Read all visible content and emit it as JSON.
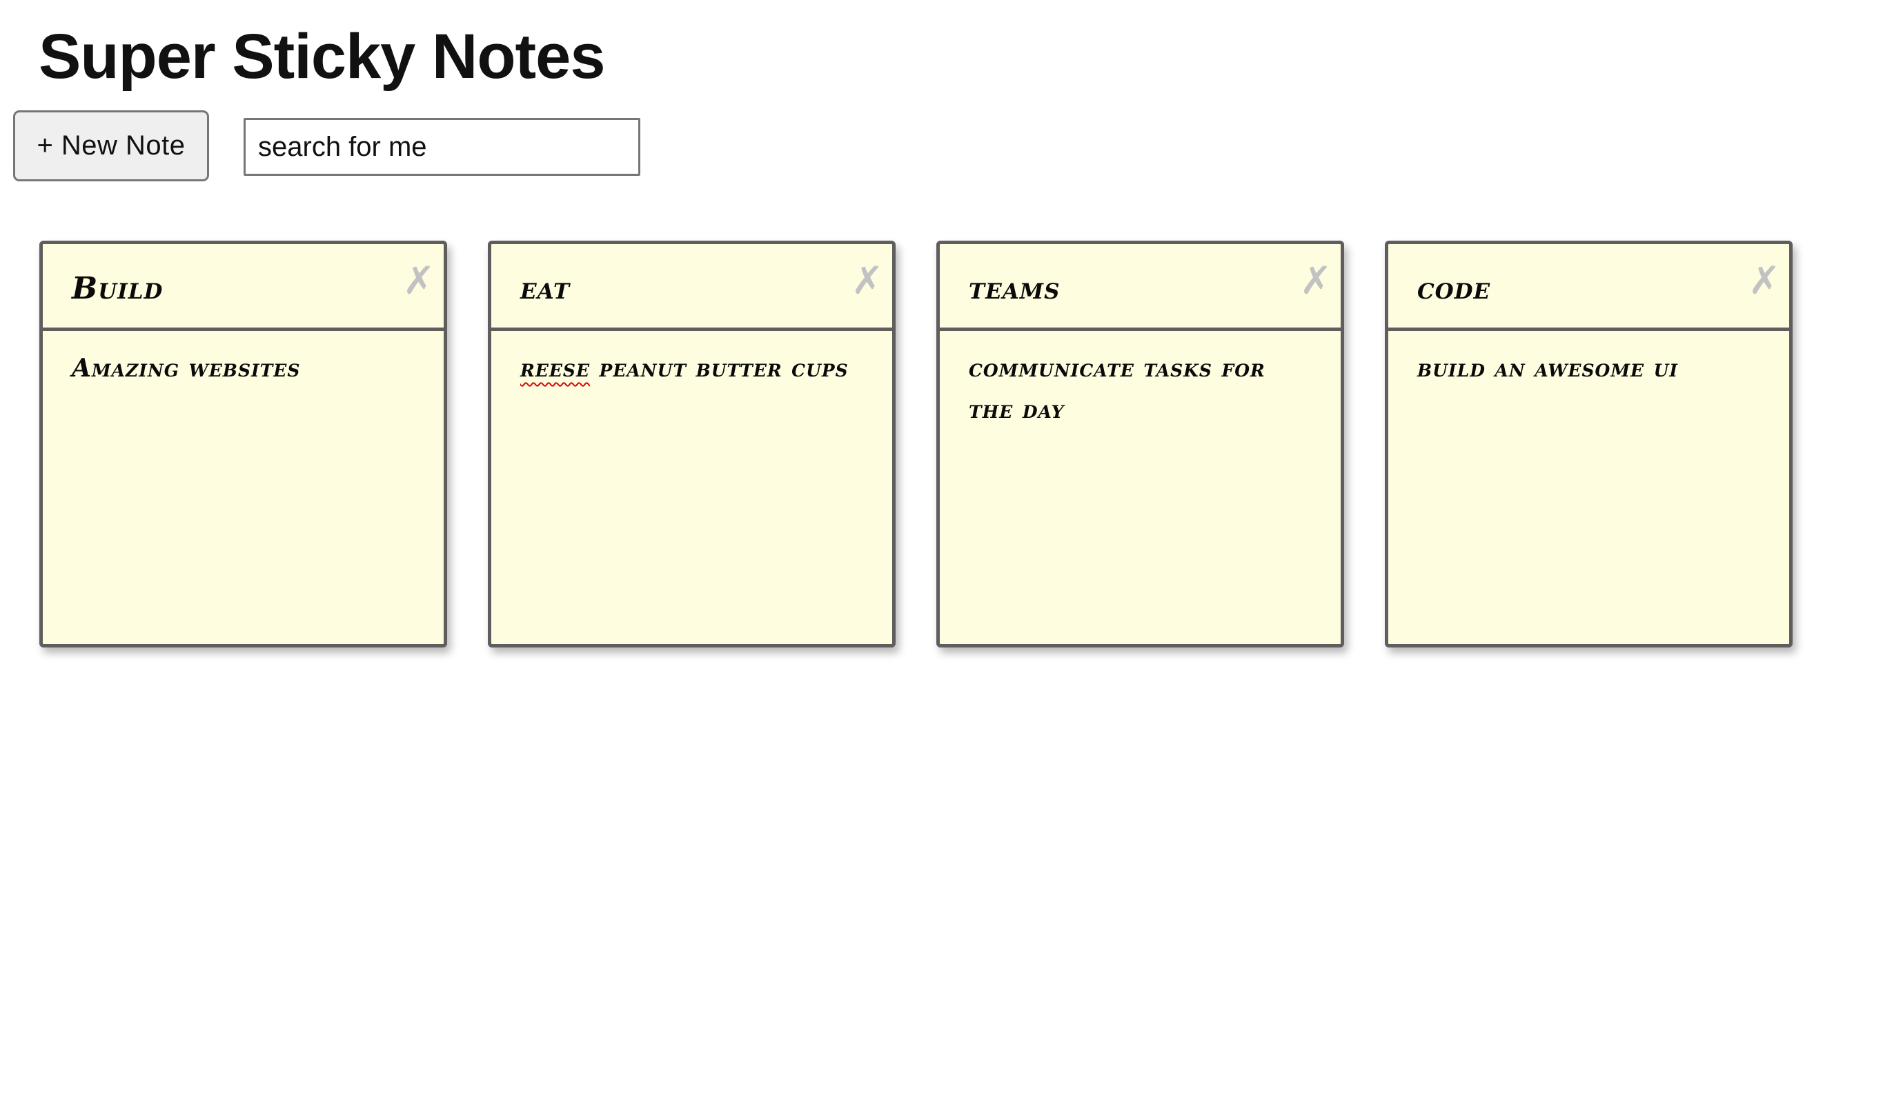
{
  "app": {
    "title": "Super Sticky Notes"
  },
  "toolbar": {
    "new_note_label": "+ New Note",
    "search_value": "search for me"
  },
  "notes": [
    {
      "title": "Build",
      "body": "Amazing websites",
      "close_icon": "close-icon"
    },
    {
      "title": "eat",
      "body_misspelled": "reese",
      "body_rest": " peanut butter cups",
      "close_icon": "close-icon"
    },
    {
      "title": "teams",
      "body": "communicate tasks for the day",
      "close_icon": "close-icon"
    },
    {
      "title": "code",
      "body": "build an awesome ui",
      "close_icon": "close-icon"
    }
  ],
  "icons": {
    "close_glyph": "✗"
  },
  "colors": {
    "note_background": "#fffde0",
    "note_border": "#5e5e5e",
    "close_icon": "#c2c2c2"
  }
}
